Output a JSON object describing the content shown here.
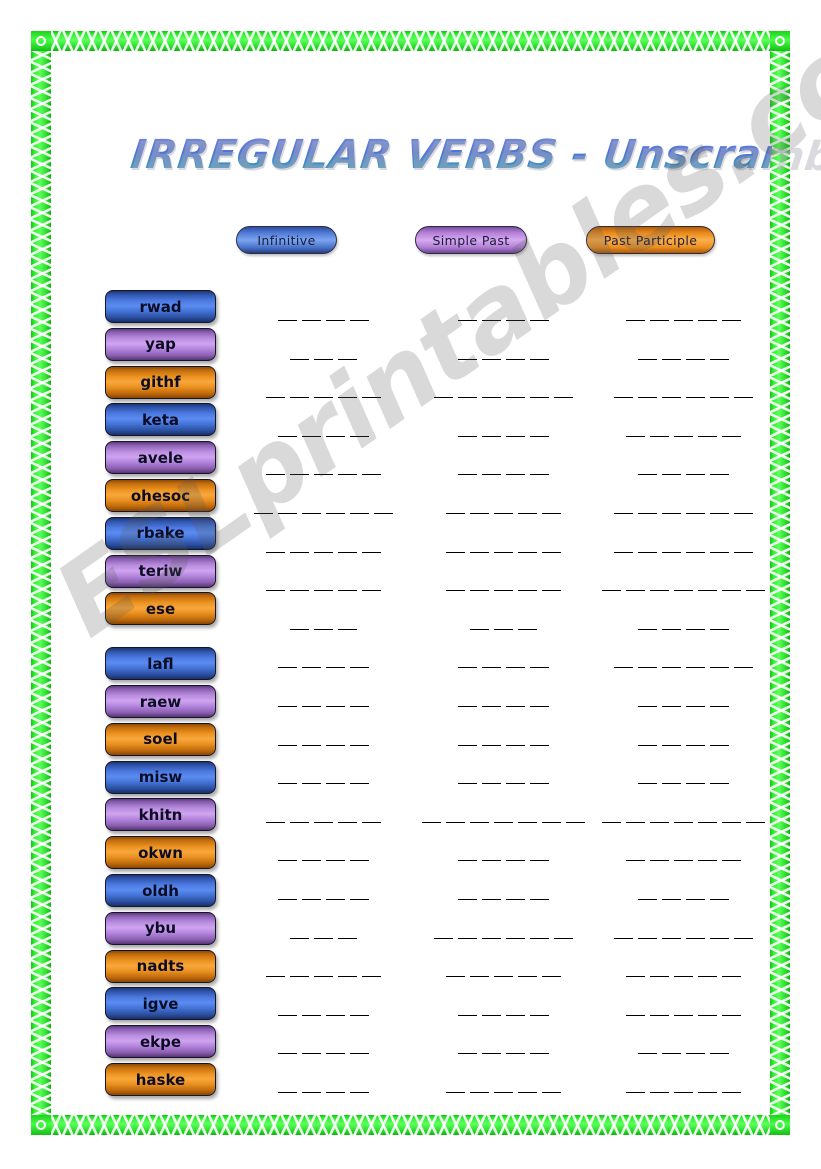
{
  "worksheet": {
    "title": "IRREGULAR VERBS - Unscramble and write",
    "watermark": "ESLprintables.com"
  },
  "colors": {
    "border_green": "#22e322",
    "blue": "#5c8cf2",
    "purple": "#cfa4ef",
    "orange": "#f9a83c",
    "title_blue": "#4f74d6",
    "title_teal": "#4d93bb",
    "dash": "#000000",
    "watermark": "#5a5a5a"
  },
  "columns": [
    {
      "label": "Infinitive",
      "color": "blue"
    },
    {
      "label": "Simple Past",
      "color": "purple"
    },
    {
      "label": "Past Participle",
      "color": "orange"
    }
  ],
  "groups": [
    {
      "words": [
        {
          "text": "rwad",
          "color": "blue"
        },
        {
          "text": "yap",
          "color": "purple"
        },
        {
          "text": "githf",
          "color": "orange"
        },
        {
          "text": "keta",
          "color": "blue"
        },
        {
          "text": "avele",
          "color": "purple"
        },
        {
          "text": "ohesoc",
          "color": "orange"
        },
        {
          "text": "rbake",
          "color": "blue"
        },
        {
          "text": "teriw",
          "color": "purple"
        },
        {
          "text": "ese",
          "color": "orange"
        }
      ]
    },
    {
      "words": [
        {
          "text": "lafl",
          "color": "blue"
        },
        {
          "text": "raew",
          "color": "purple"
        },
        {
          "text": "soel",
          "color": "orange"
        },
        {
          "text": "misw",
          "color": "blue"
        },
        {
          "text": "khitn",
          "color": "purple"
        },
        {
          "text": "okwn",
          "color": "orange"
        },
        {
          "text": "oldh",
          "color": "blue"
        },
        {
          "text": "ybu",
          "color": "purple"
        },
        {
          "text": "nadts",
          "color": "orange"
        },
        {
          "text": "igve",
          "color": "blue"
        },
        {
          "text": "ekpe",
          "color": "purple"
        },
        {
          "text": "haske",
          "color": "orange"
        }
      ]
    }
  ],
  "answer_rows": [
    {
      "dashes": [
        4,
        4,
        5
      ]
    },
    {
      "dashes": [
        3,
        4,
        4
      ]
    },
    {
      "dashes": [
        5,
        6,
        6
      ]
    },
    {
      "dashes": [
        4,
        4,
        5
      ]
    },
    {
      "dashes": [
        5,
        4,
        4
      ]
    },
    {
      "dashes": [
        6,
        5,
        6
      ]
    },
    {
      "dashes": [
        5,
        5,
        6
      ]
    },
    {
      "dashes": [
        5,
        5,
        7
      ]
    },
    {
      "dashes": [
        3,
        3,
        4
      ]
    },
    {
      "dashes": [
        4,
        4,
        6
      ]
    },
    {
      "dashes": [
        4,
        4,
        4
      ]
    },
    {
      "dashes": [
        4,
        4,
        4
      ]
    },
    {
      "dashes": [
        4,
        4,
        4
      ]
    },
    {
      "dashes": [
        5,
        7,
        7
      ]
    },
    {
      "dashes": [
        4,
        4,
        5
      ]
    },
    {
      "dashes": [
        4,
        4,
        4
      ]
    },
    {
      "dashes": [
        3,
        6,
        6
      ]
    },
    {
      "dashes": [
        5,
        5,
        5
      ]
    },
    {
      "dashes": [
        4,
        4,
        5
      ]
    },
    {
      "dashes": [
        4,
        4,
        4
      ]
    },
    {
      "dashes": [
        4,
        5,
        5
      ]
    }
  ]
}
